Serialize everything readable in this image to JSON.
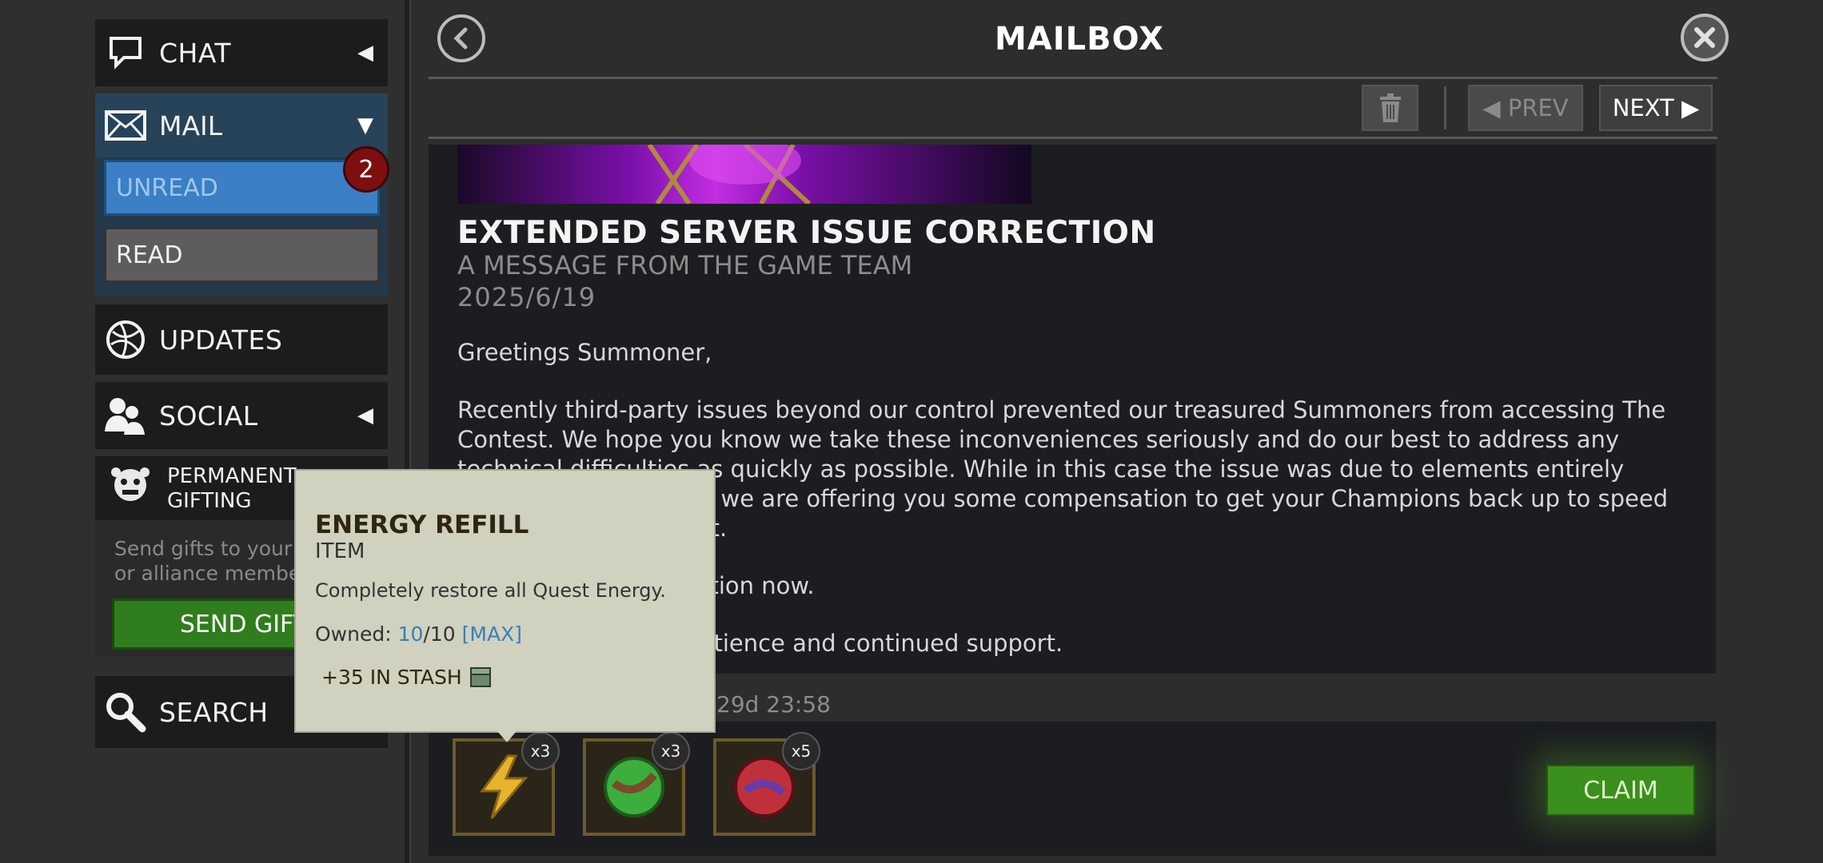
{
  "app": {
    "title": "MAILBOX"
  },
  "sidebar": {
    "chat": {
      "label": "CHAT",
      "arrow": "◀"
    },
    "mail": {
      "label": "MAIL",
      "arrow": "▼",
      "folders": [
        {
          "label": "UNREAD"
        },
        {
          "label": "READ"
        }
      ],
      "unread_count": "2"
    },
    "updates": {
      "label": "UPDATES"
    },
    "social": {
      "label": "SOCIAL",
      "arrow": "◀"
    },
    "gifting": {
      "label_line1": "PERMANENT",
      "label_line2": "GIFTING",
      "desc_line1": "Send gifts to your",
      "desc_line2": "or alliance membe",
      "send_label": "SEND GIFT"
    },
    "search": {
      "label": "SEARCH"
    }
  },
  "toolbar": {
    "prev_label": "◀ PREV",
    "next_label": "NEXT ▶"
  },
  "message": {
    "title": "EXTENDED SERVER ISSUE CORRECTION",
    "subtitle": "A MESSAGE FROM THE GAME TEAM",
    "date": "2025/6/19",
    "greeting": "Greetings Summoner,",
    "para1": "Recently third-party issues beyond our control prevented our treasured Summoners from accessing The Contest. We hope you know we take these inconveniences seriously and do our best to address any technical difficulties as quickly as possible. While in this case the issue was due to elements entirely outside of our control, we are offering you some compensation to get your Champions back up to speed in the exciting Contest.",
    "para2": "Claim your compensation now.",
    "para3": "Thank you for your patience and continued support.",
    "expiry": "29d 23:58"
  },
  "rewards": [
    {
      "name": "energy-refill",
      "count": "x3",
      "color": "#e6b32e"
    },
    {
      "name": "green-crystal",
      "count": "x3",
      "color": "#3cae3c"
    },
    {
      "name": "red-crystal",
      "count": "x5",
      "color": "#c0303a"
    }
  ],
  "claim_label": "CLAIM",
  "tooltip": {
    "title": "ENERGY REFILL",
    "subtitle": "ITEM",
    "description": "Completely restore all Quest Energy.",
    "owned_label": "Owned:",
    "owned_value": "10",
    "owned_sep": "/",
    "owned_max": "10",
    "owned_max_tag": "[MAX]",
    "stash": "+35 IN STASH"
  },
  "colors": {
    "accent_blue": "#3b7fc4",
    "claim_green": "#3b8f1d",
    "badge_red": "#7d0f0f"
  }
}
